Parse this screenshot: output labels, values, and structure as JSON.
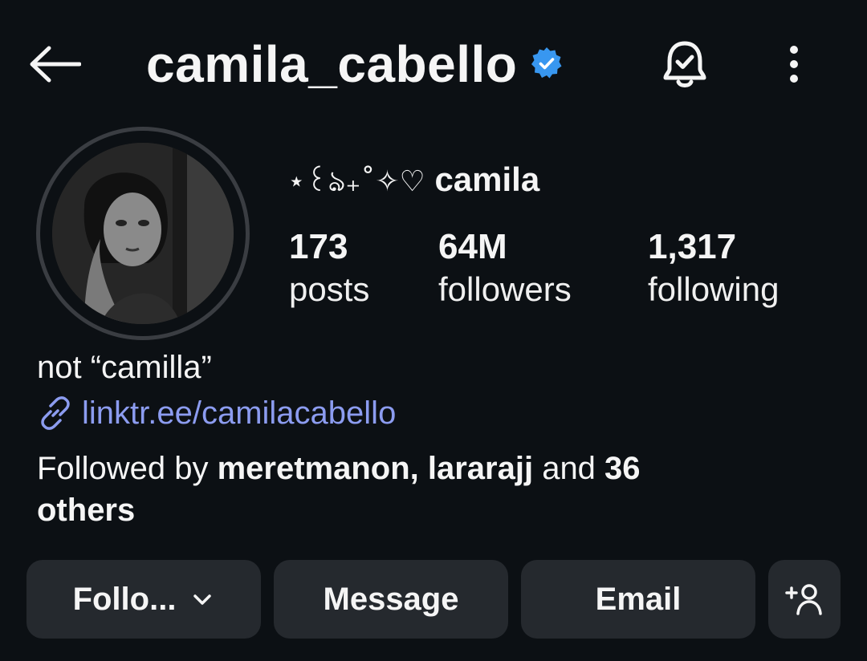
{
  "header": {
    "username": "camila_cabello",
    "verified_color": "#3897f0"
  },
  "profile": {
    "display_name_decoration": "⋆꒰ঌ₊˚✧♡",
    "display_name": "camila",
    "stats": [
      {
        "value": "173",
        "label": "posts"
      },
      {
        "value": "64M",
        "label": "followers"
      },
      {
        "value": "1,317",
        "label": "following"
      }
    ],
    "bio": "not “camilla”",
    "link": "linktr.ee/camilacabello",
    "followed_by": {
      "prefix": "Followed by ",
      "user1": "meretmanon",
      "sep": ", ",
      "user2": "lararajj",
      "mid": " and ",
      "count": "36",
      "suffix": "others"
    }
  },
  "actions": {
    "follow": "Follo...",
    "message": "Message",
    "email": "Email"
  },
  "icons": {
    "back": "back-arrow-icon",
    "verified": "verified-badge-icon",
    "bell": "notification-bell-icon",
    "more": "more-options-icon",
    "link": "link-icon",
    "chevron": "chevron-down-icon",
    "add_user": "add-user-icon"
  },
  "colors": {
    "background": "#0c1014",
    "button": "#25292e",
    "link": "#8c9cf0"
  }
}
